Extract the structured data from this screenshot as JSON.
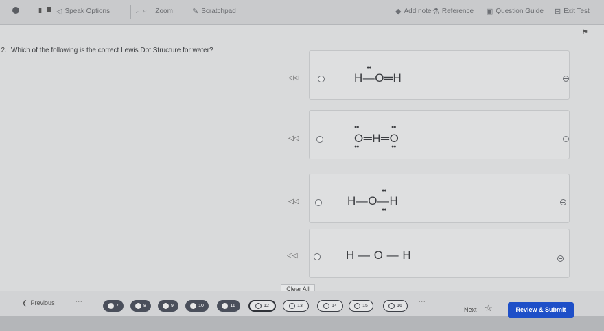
{
  "toolbar": {
    "speak_options": "Speak Options",
    "zoom": "Zoom",
    "scratchpad": "Scratchpad",
    "add_note": "Add note",
    "reference": "Reference",
    "question_guide": "Question Guide",
    "exit_test": "Exit Test"
  },
  "question": {
    "number": "12.",
    "prompt": "Which of the following is the correct Lewis Dot Structure for water?"
  },
  "options": [
    {
      "formula": "H—O═H"
    },
    {
      "formula": "O═H═O"
    },
    {
      "formula": "H—O—H"
    },
    {
      "formula": "H — O — H"
    }
  ],
  "clear_all": "Clear All",
  "nav": {
    "previous": "Previous",
    "dots": "...",
    "questions": [
      {
        "label": "7",
        "state": "done"
      },
      {
        "label": "8",
        "state": "done"
      },
      {
        "label": "9",
        "state": "done"
      },
      {
        "label": "10",
        "state": "done"
      },
      {
        "label": "11",
        "state": "done"
      },
      {
        "label": "12",
        "state": "current"
      },
      {
        "label": "13",
        "state": "todo"
      },
      {
        "label": "14",
        "state": "todo"
      },
      {
        "label": "15",
        "state": "todo"
      },
      {
        "label": "16",
        "state": "todo"
      }
    ],
    "next": "Next",
    "submit": "Review & Submit"
  },
  "colors": {
    "submit_bg": "#1e4fc8",
    "answered_bg": "#4a4f5b"
  }
}
